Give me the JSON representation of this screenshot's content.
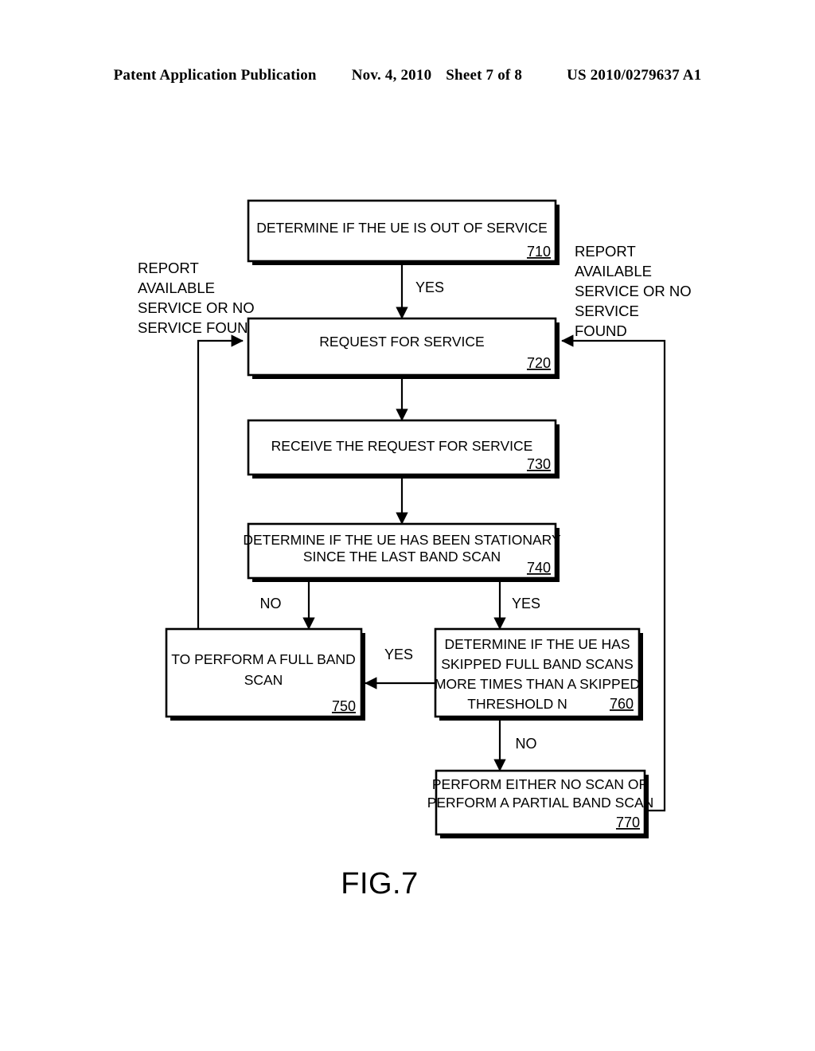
{
  "header": {
    "publication": "Patent Application Publication",
    "date": "Nov. 4, 2010",
    "sheet": "Sheet 7 of 8",
    "patent_number": "US 2010/0279637 A1"
  },
  "figure": {
    "caption": "FIG.7",
    "nodes": [
      {
        "id": "710",
        "ref": "710",
        "lines": [
          "DETERMINE IF THE UE IS OUT OF SERVICE"
        ]
      },
      {
        "id": "720",
        "ref": "720",
        "lines": [
          "REQUEST FOR SERVICE"
        ]
      },
      {
        "id": "730",
        "ref": "730",
        "lines": [
          "RECEIVE THE REQUEST FOR SERVICE"
        ]
      },
      {
        "id": "740",
        "ref": "740",
        "lines": [
          "DETERMINE IF THE UE HAS BEEN STATIONARY",
          "SINCE THE LAST BAND SCAN"
        ]
      },
      {
        "id": "750",
        "ref": "750",
        "lines": [
          "TO PERFORM A FULL BAND",
          "SCAN"
        ]
      },
      {
        "id": "760",
        "ref": "760",
        "lines": [
          "DETERMINE IF THE UE HAS",
          "SKIPPED FULL BAND SCANS",
          "MORE TIMES THAN A SKIPPED",
          "THRESHOLD N"
        ]
      },
      {
        "id": "770",
        "ref": "770",
        "lines": [
          "PERFORM EITHER NO SCAN OR",
          "PERFORM A PARTIAL BAND SCAN"
        ]
      }
    ],
    "edge_labels": {
      "yes_710_720": "YES",
      "no_740_750": "NO",
      "yes_740_760": "YES",
      "yes_760_750": "YES",
      "no_760_770": "NO"
    },
    "annotations": {
      "left_note": [
        "REPORT",
        "AVAILABLE",
        "SERVICE OR NO",
        "SERVICE FOUND"
      ],
      "right_note": [
        "REPORT",
        "AVAILABLE",
        "SERVICE OR NO",
        "SERVICE",
        "FOUND"
      ]
    },
    "colors": {
      "ink": "#000000",
      "paper": "#ffffff"
    }
  }
}
